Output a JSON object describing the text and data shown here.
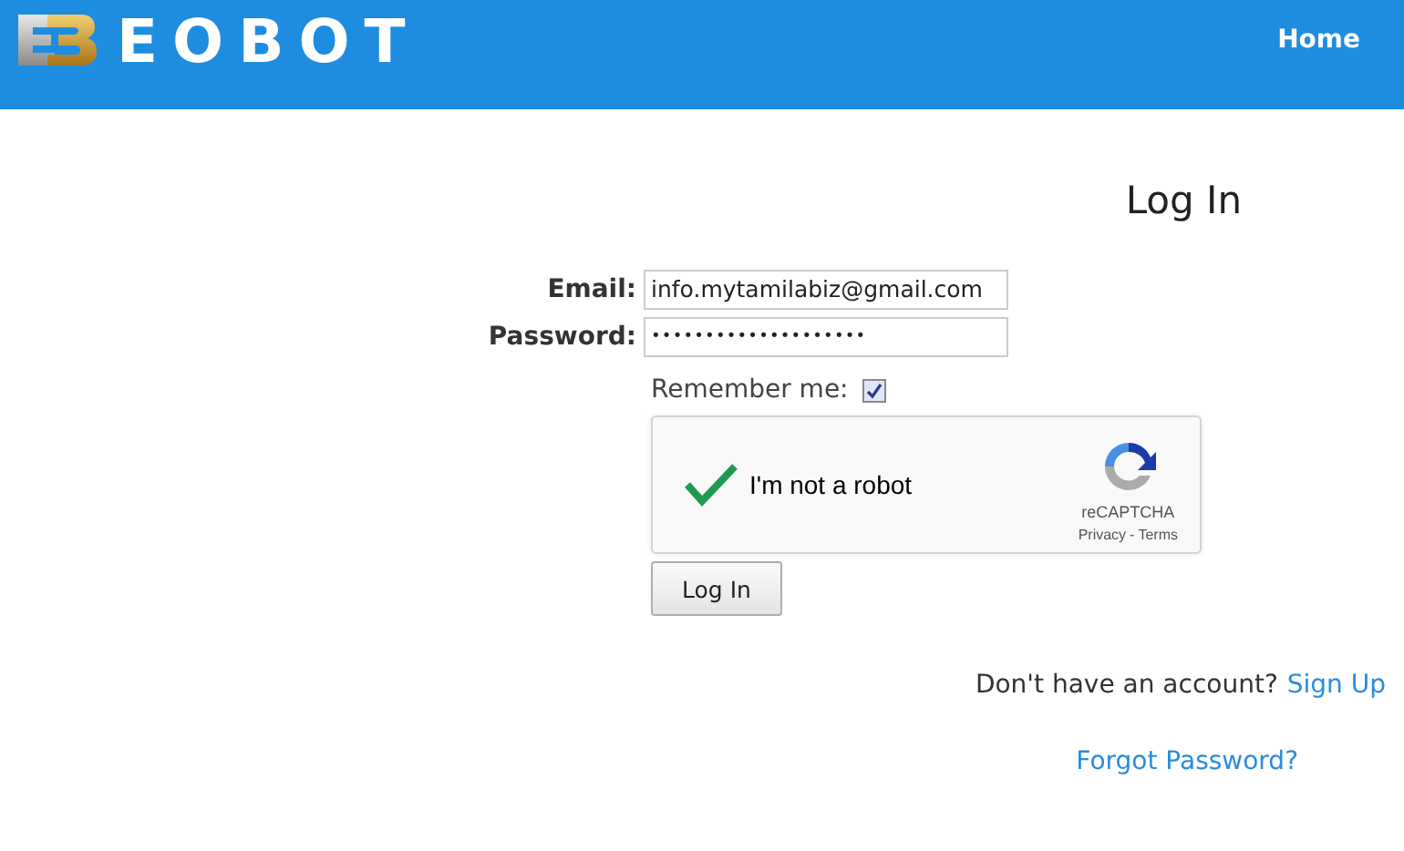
{
  "header": {
    "brand": "EOBOT",
    "nav": [
      {
        "label": "Home"
      }
    ]
  },
  "title": "Log In",
  "form": {
    "fields": [
      {
        "label": "Email:",
        "kind": "text",
        "value": "info.mytamilabiz@gmail.com"
      },
      {
        "label": "Password:",
        "kind": "password",
        "value": "••••••••••••••••••••"
      }
    ],
    "remember": {
      "label": "Remember me:",
      "checked": true
    },
    "captcha": {
      "checked": true,
      "label": "I'm not a robot",
      "brand": "reCAPTCHA",
      "links": [
        "Privacy",
        "Terms"
      ],
      "separator": "-"
    },
    "submit": "Log In"
  },
  "signup": {
    "text": "Don't have an account?",
    "link": "Sign Up"
  },
  "forgot": "Forgot Password?"
}
